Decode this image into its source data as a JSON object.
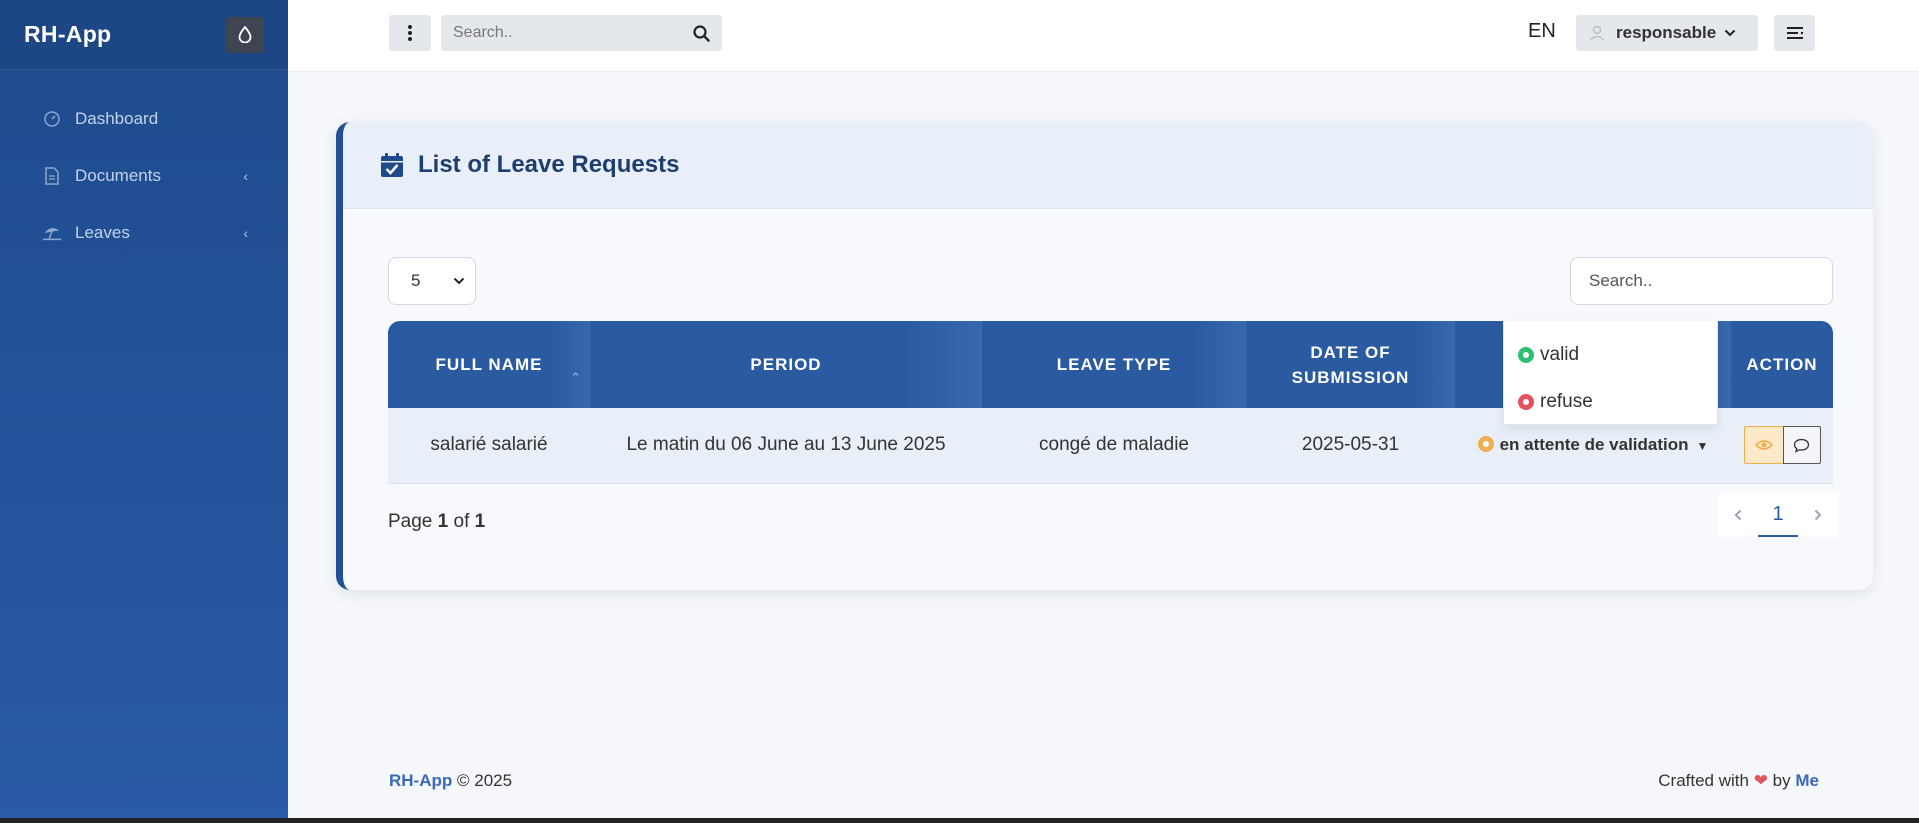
{
  "app": {
    "brand": "RH-App"
  },
  "sidebar": {
    "items": [
      {
        "label": "Dashboard",
        "icon": "gauge-icon"
      },
      {
        "label": "Documents",
        "icon": "document-icon",
        "chevron": "‹"
      },
      {
        "label": "Leaves",
        "icon": "umbrella-beach-icon",
        "chevron": "‹"
      }
    ]
  },
  "topbar": {
    "search_placeholder": "Search..",
    "language": "EN",
    "user": "responsable"
  },
  "card": {
    "title": "List of Leave Requests",
    "page_length": "5",
    "search_placeholder": "Search..",
    "columns": [
      "FULL NAME",
      "PERIOD",
      "LEAVE TYPE",
      "DATE OF SUBMISSION",
      "ACTION"
    ],
    "rows": [
      {
        "full_name": "salarié salarié",
        "period": "Le matin du 06 June au 13 June 2025",
        "leave_type": "congé de maladie",
        "date": "2025-05-31",
        "status": "en attente de validation"
      }
    ],
    "status_options": [
      {
        "label": "valid",
        "color": "#2fbf71"
      },
      {
        "label": "refuse",
        "color": "#e2545b"
      }
    ],
    "page_info": {
      "prefix": "Page",
      "current": "1",
      "middle": "of",
      "total": "1"
    },
    "pager": {
      "current": "1"
    }
  },
  "footer": {
    "brand": "RH-App",
    "copyright": "© 2025",
    "crafted": "Crafted with",
    "by": "by",
    "author": "Me"
  },
  "colors": {
    "primary": "#2a5aa0",
    "sidebar": "#1e4a8c",
    "pending": "#f0ad4e"
  }
}
